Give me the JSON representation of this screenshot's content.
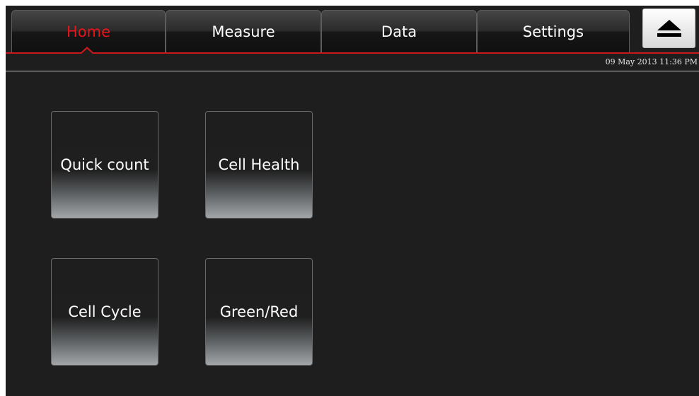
{
  "tabs": [
    {
      "label": "Home",
      "active": true
    },
    {
      "label": "Measure",
      "active": false
    },
    {
      "label": "Data",
      "active": false
    },
    {
      "label": "Settings",
      "active": false
    }
  ],
  "eject_icon": "eject-icon",
  "datetime": "09 May 2013  11:36 PM",
  "tiles": [
    {
      "label": "Quick count"
    },
    {
      "label": "Cell Health"
    },
    {
      "label": "Cell Cycle"
    },
    {
      "label": "Green/Red"
    }
  ],
  "colors": {
    "accent_red": "#e8141b",
    "background": "#1e1e1e",
    "text": "#ffffff"
  }
}
